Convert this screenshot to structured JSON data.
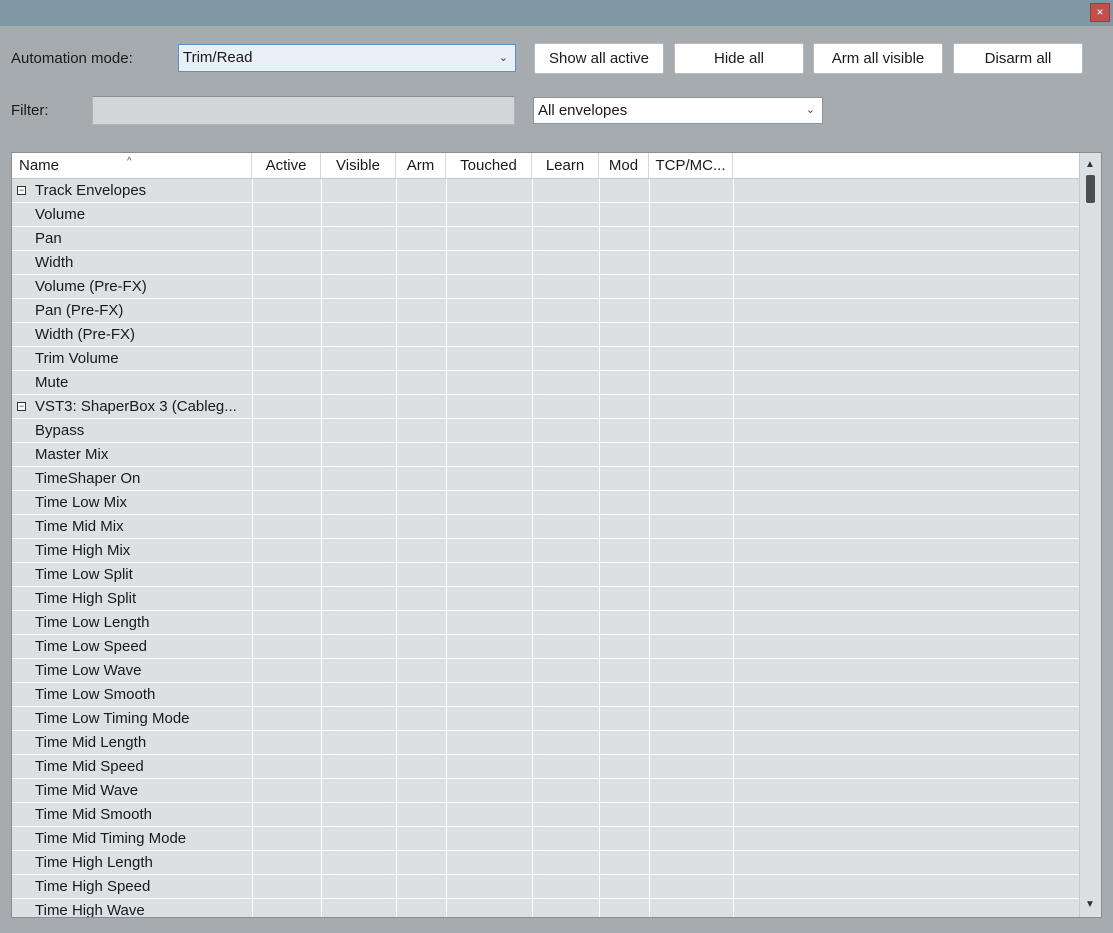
{
  "window": {
    "close_glyph": "×"
  },
  "controls": {
    "automation_label": "Automation mode:",
    "automation_value": "Trim/Read",
    "filter_label": "Filter:",
    "filter_value": "",
    "envelope_filter_value": "All envelopes",
    "buttons": [
      "Show all active",
      "Hide all",
      "Arm all visible",
      "Disarm all"
    ]
  },
  "table": {
    "columns": [
      "Name",
      "Active",
      "Visible",
      "Arm",
      "Touched",
      "Learn",
      "Mod",
      "TCP/MC..."
    ],
    "sort_indicator": "^",
    "rows": [
      {
        "label": "Track Envelopes",
        "group": true
      },
      {
        "label": "Volume"
      },
      {
        "label": "Pan"
      },
      {
        "label": "Width"
      },
      {
        "label": "Volume (Pre-FX)"
      },
      {
        "label": "Pan (Pre-FX)"
      },
      {
        "label": "Width (Pre-FX)"
      },
      {
        "label": "Trim Volume"
      },
      {
        "label": "Mute"
      },
      {
        "label": "VST3: ShaperBox 3 (Cableg...",
        "group": true
      },
      {
        "label": "Bypass"
      },
      {
        "label": "Master Mix"
      },
      {
        "label": "TimeShaper On"
      },
      {
        "label": "Time Low Mix"
      },
      {
        "label": "Time Mid Mix"
      },
      {
        "label": "Time High Mix"
      },
      {
        "label": "Time Low Split"
      },
      {
        "label": "Time High Split"
      },
      {
        "label": "Time Low Length"
      },
      {
        "label": "Time Low Speed"
      },
      {
        "label": "Time Low Wave"
      },
      {
        "label": "Time Low Smooth"
      },
      {
        "label": "Time Low Timing Mode"
      },
      {
        "label": "Time Mid Length"
      },
      {
        "label": "Time Mid Speed"
      },
      {
        "label": "Time Mid Wave"
      },
      {
        "label": "Time Mid Smooth"
      },
      {
        "label": "Time Mid Timing Mode"
      },
      {
        "label": "Time High Length"
      },
      {
        "label": "Time High Speed"
      },
      {
        "label": "Time High Wave"
      }
    ],
    "expander_glyph": "−"
  },
  "scrollbar": {
    "position": 0.0,
    "up_glyph": "▲",
    "down_glyph": "▼"
  }
}
